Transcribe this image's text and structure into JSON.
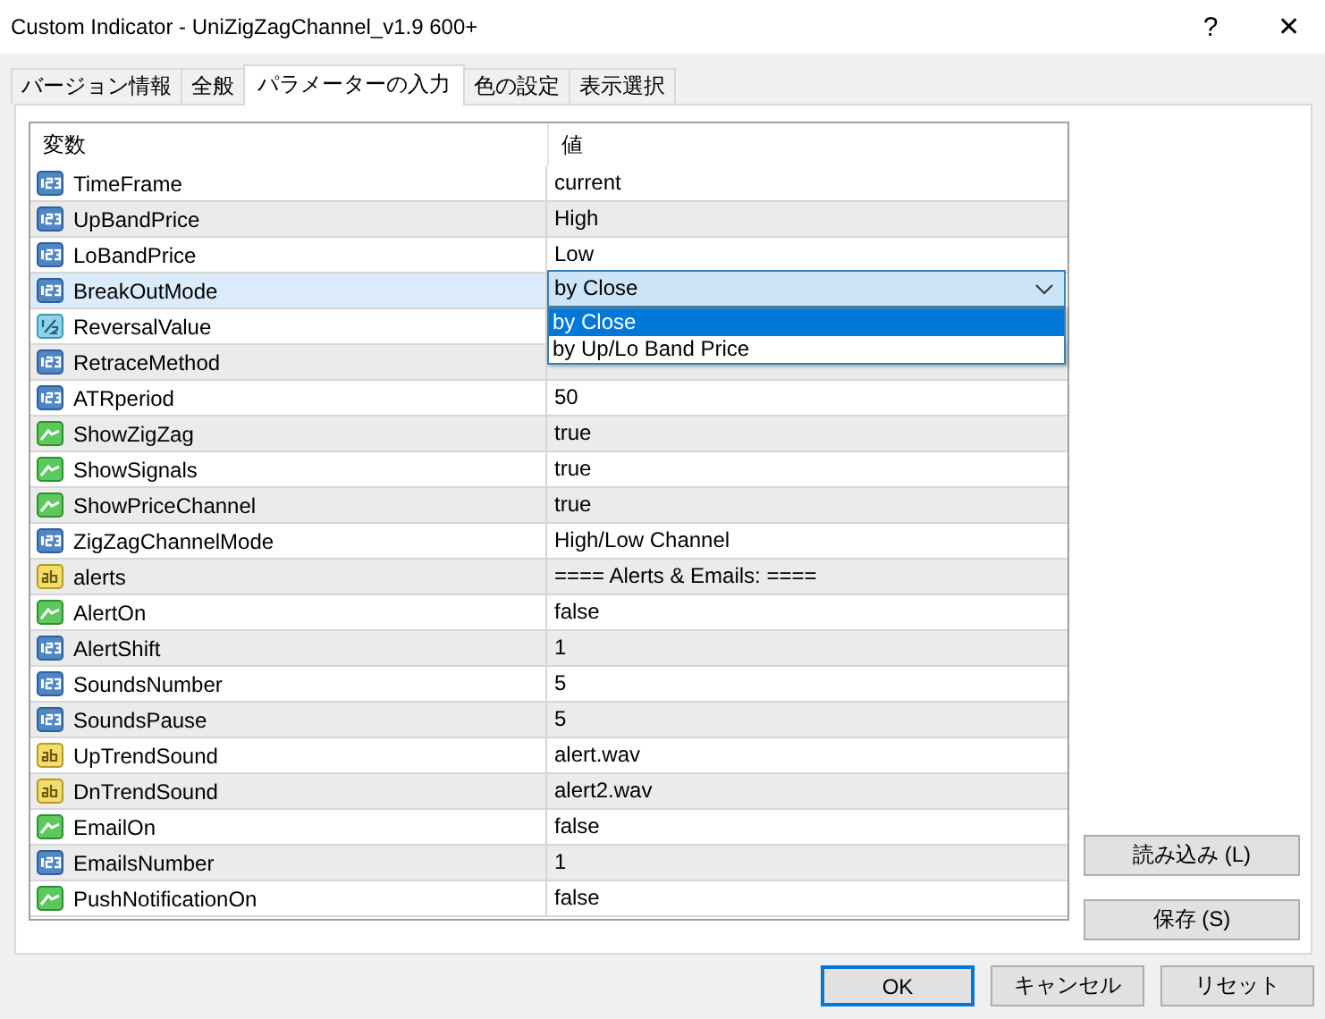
{
  "window": {
    "title": "Custom Indicator - UniZigZagChannel_v1.9 600+",
    "help": "?",
    "close": "✕"
  },
  "tabs": [
    {
      "label": "バージョン情報",
      "selected": false
    },
    {
      "label": "全般",
      "selected": false
    },
    {
      "label": "パラメーターの入力",
      "selected": true
    },
    {
      "label": "色の設定",
      "selected": false
    },
    {
      "label": "表示選択",
      "selected": false
    }
  ],
  "table": {
    "columns": [
      "変数",
      "値"
    ],
    "rows": [
      {
        "kind": "int",
        "name": "TimeFrame",
        "value": "current",
        "selected": false
      },
      {
        "kind": "int",
        "name": "UpBandPrice",
        "value": "High",
        "selected": false
      },
      {
        "kind": "int",
        "name": "LoBandPrice",
        "value": "Low",
        "selected": false
      },
      {
        "kind": "int",
        "name": "BreakOutMode",
        "value": "by Close",
        "selected": true,
        "dropdown": {
          "options": [
            {
              "label": "by Close",
              "selected": true
            },
            {
              "label": "by Up/Lo Band Price",
              "selected": false
            }
          ]
        }
      },
      {
        "kind": "double",
        "name": "ReversalValue",
        "selected": false
      },
      {
        "kind": "int",
        "name": "RetraceMethod",
        "selected": false
      },
      {
        "kind": "int",
        "name": "ATRperiod",
        "value": "50",
        "selected": false
      },
      {
        "kind": "bool",
        "name": "ShowZigZag",
        "value": "true",
        "selected": false
      },
      {
        "kind": "bool",
        "name": "ShowSignals",
        "value": "true",
        "selected": false
      },
      {
        "kind": "bool",
        "name": "ShowPriceChannel",
        "value": "true",
        "selected": false
      },
      {
        "kind": "int",
        "name": "ZigZagChannelMode",
        "value": "High/Low Channel",
        "selected": false
      },
      {
        "kind": "string",
        "name": "alerts",
        "value": "==== Alerts & Emails: ====",
        "selected": false
      },
      {
        "kind": "bool",
        "name": "AlertOn",
        "value": "false",
        "selected": false
      },
      {
        "kind": "int",
        "name": "AlertShift",
        "value": "1",
        "selected": false
      },
      {
        "kind": "int",
        "name": "SoundsNumber",
        "value": "5",
        "selected": false
      },
      {
        "kind": "int",
        "name": "SoundsPause",
        "value": "5",
        "selected": false
      },
      {
        "kind": "string",
        "name": "UpTrendSound",
        "value": "alert.wav",
        "selected": false
      },
      {
        "kind": "string",
        "name": "DnTrendSound",
        "value": "alert2.wav",
        "selected": false
      },
      {
        "kind": "bool",
        "name": "EmailOn",
        "value": "false",
        "selected": false
      },
      {
        "kind": "int",
        "name": "EmailsNumber",
        "value": "1",
        "selected": false
      },
      {
        "kind": "bool",
        "name": "PushNotificationOn",
        "value": "false",
        "selected": false
      }
    ]
  },
  "side_buttons": [
    "読み込み (L)",
    "保存 (S)"
  ],
  "buttons": [
    {
      "label": "OK",
      "default": true
    },
    {
      "label": "キャンセル",
      "default": false
    },
    {
      "label": "リセット",
      "default": false
    }
  ]
}
